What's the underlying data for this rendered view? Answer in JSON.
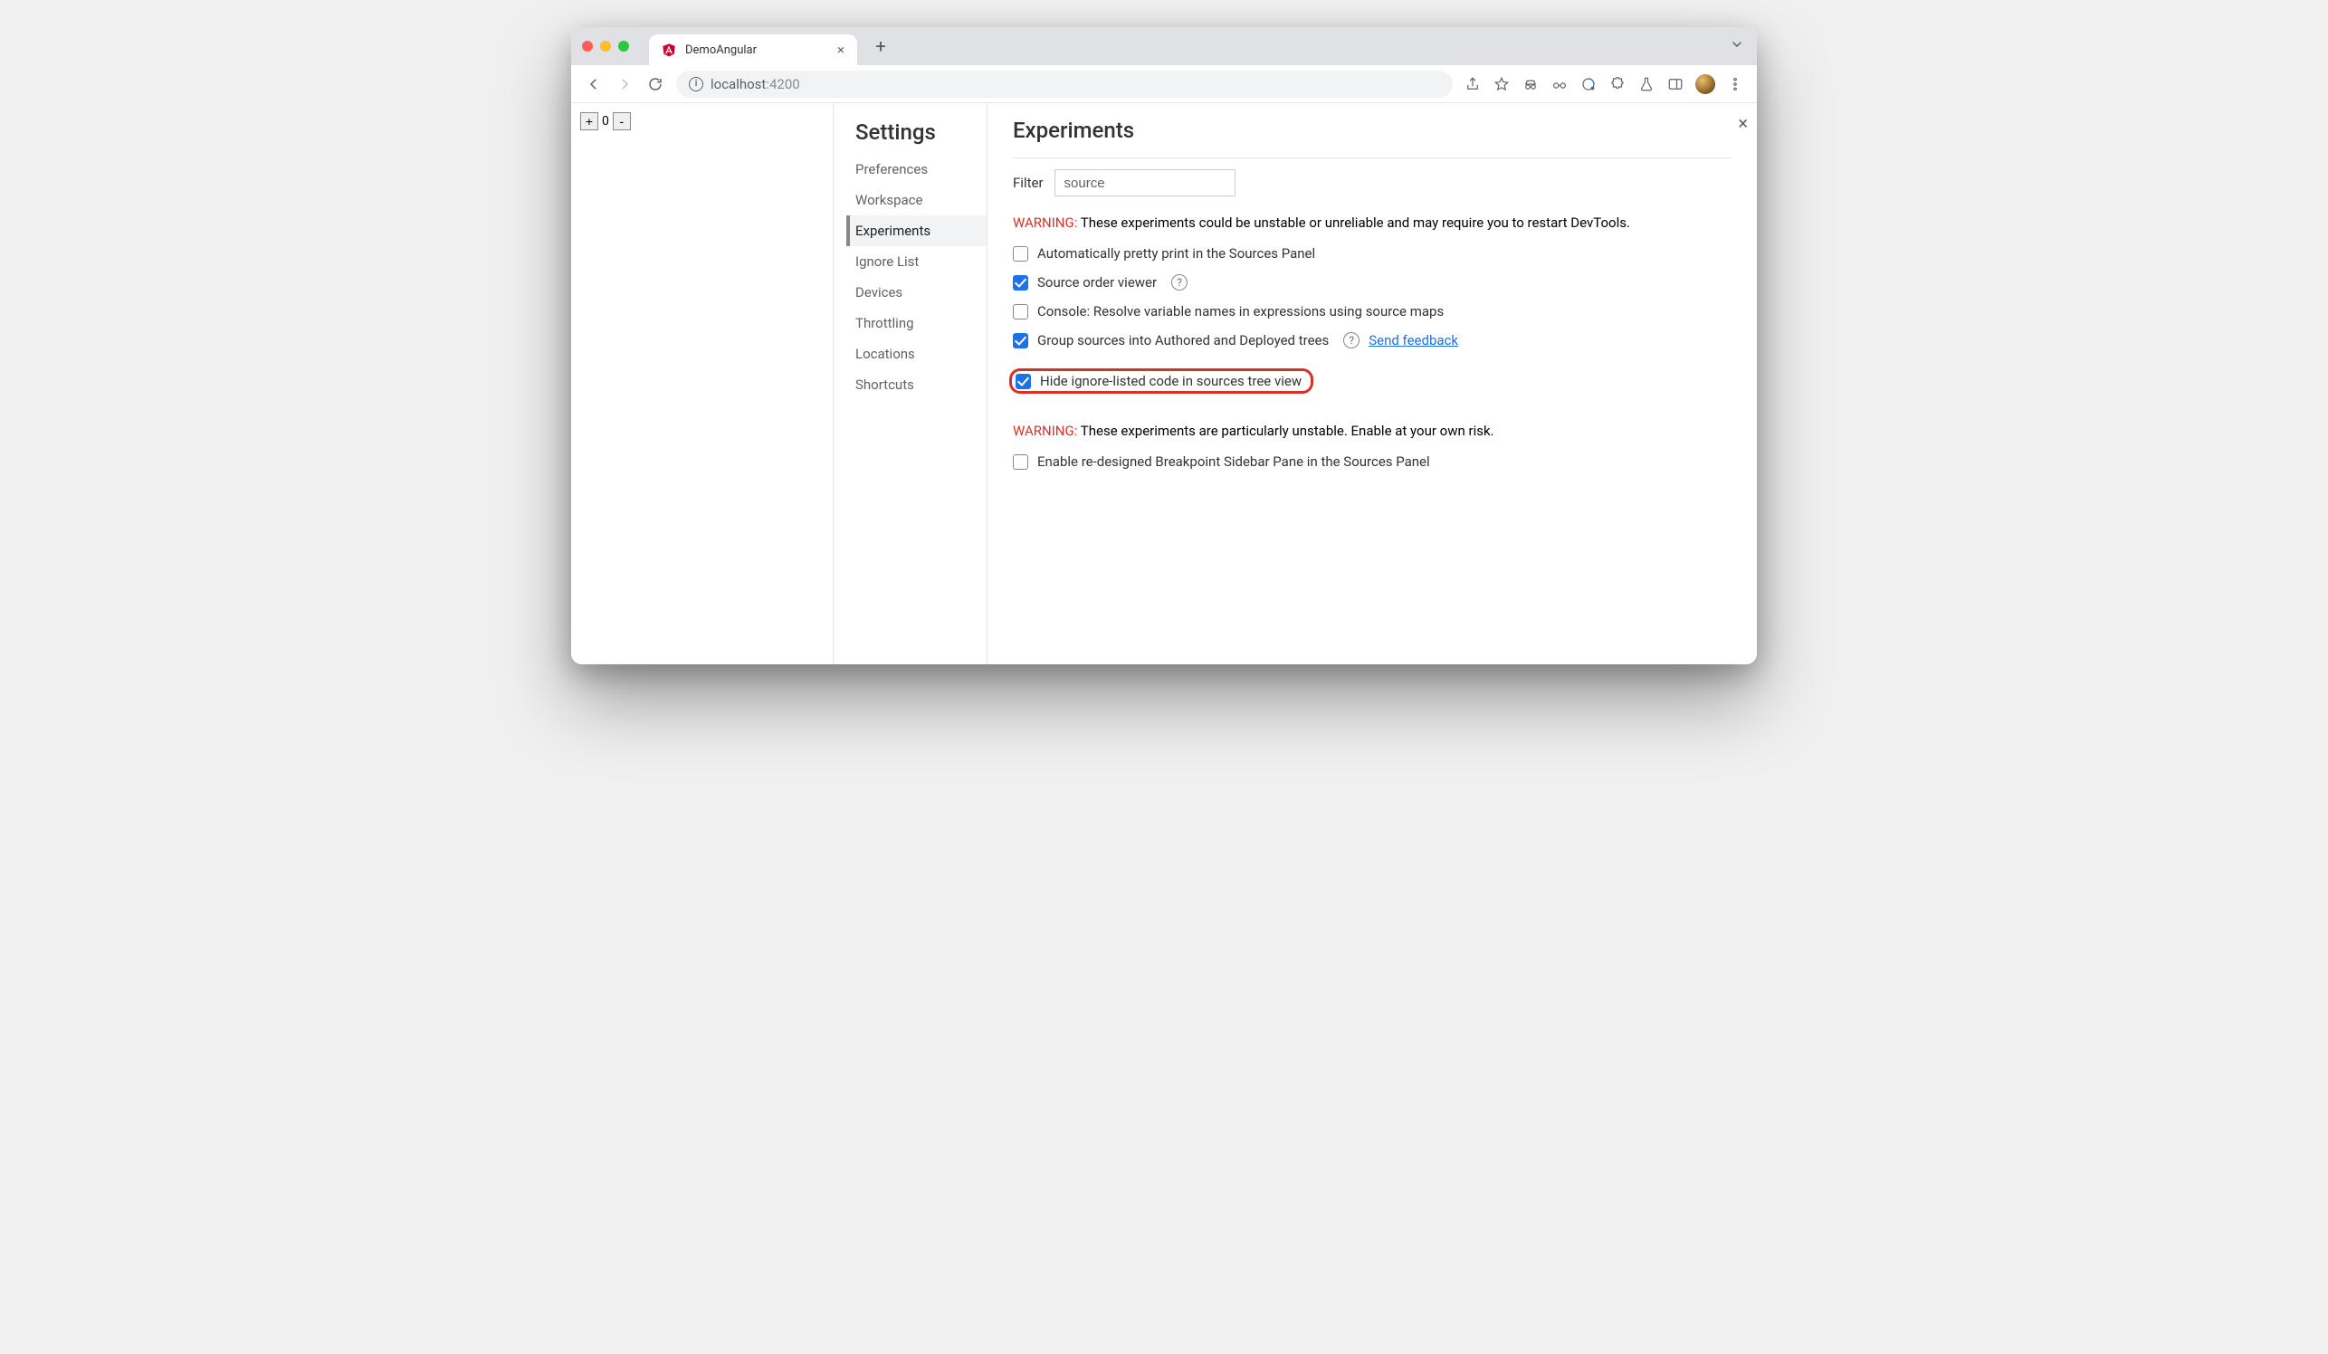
{
  "tab": {
    "title": "DemoAngular"
  },
  "url": {
    "host": "localhost",
    "port": ":4200"
  },
  "page": {
    "counter_value": "0"
  },
  "sidebar": {
    "title": "Settings",
    "items": [
      {
        "label": "Preferences"
      },
      {
        "label": "Workspace"
      },
      {
        "label": "Experiments"
      },
      {
        "label": "Ignore List"
      },
      {
        "label": "Devices"
      },
      {
        "label": "Throttling"
      },
      {
        "label": "Locations"
      },
      {
        "label": "Shortcuts"
      }
    ]
  },
  "panel": {
    "heading": "Experiments",
    "filter_label": "Filter",
    "filter_value": "source",
    "warning1_prefix": "WARNING:",
    "warning1_text": " These experiments could be unstable or unreliable and may require you to restart DevTools.",
    "warning2_prefix": "WARNING:",
    "warning2_text": " These experiments are particularly unstable. Enable at your own risk.",
    "feedback_link": "Send feedback",
    "exp": [
      {
        "label": "Automatically pretty print in the Sources Panel"
      },
      {
        "label": "Source order viewer"
      },
      {
        "label": "Console: Resolve variable names in expressions using source maps"
      },
      {
        "label": "Group sources into Authored and Deployed trees"
      },
      {
        "label": "Hide ignore-listed code in sources tree view"
      },
      {
        "label": "Enable re-designed Breakpoint Sidebar Pane in the Sources Panel"
      }
    ]
  }
}
